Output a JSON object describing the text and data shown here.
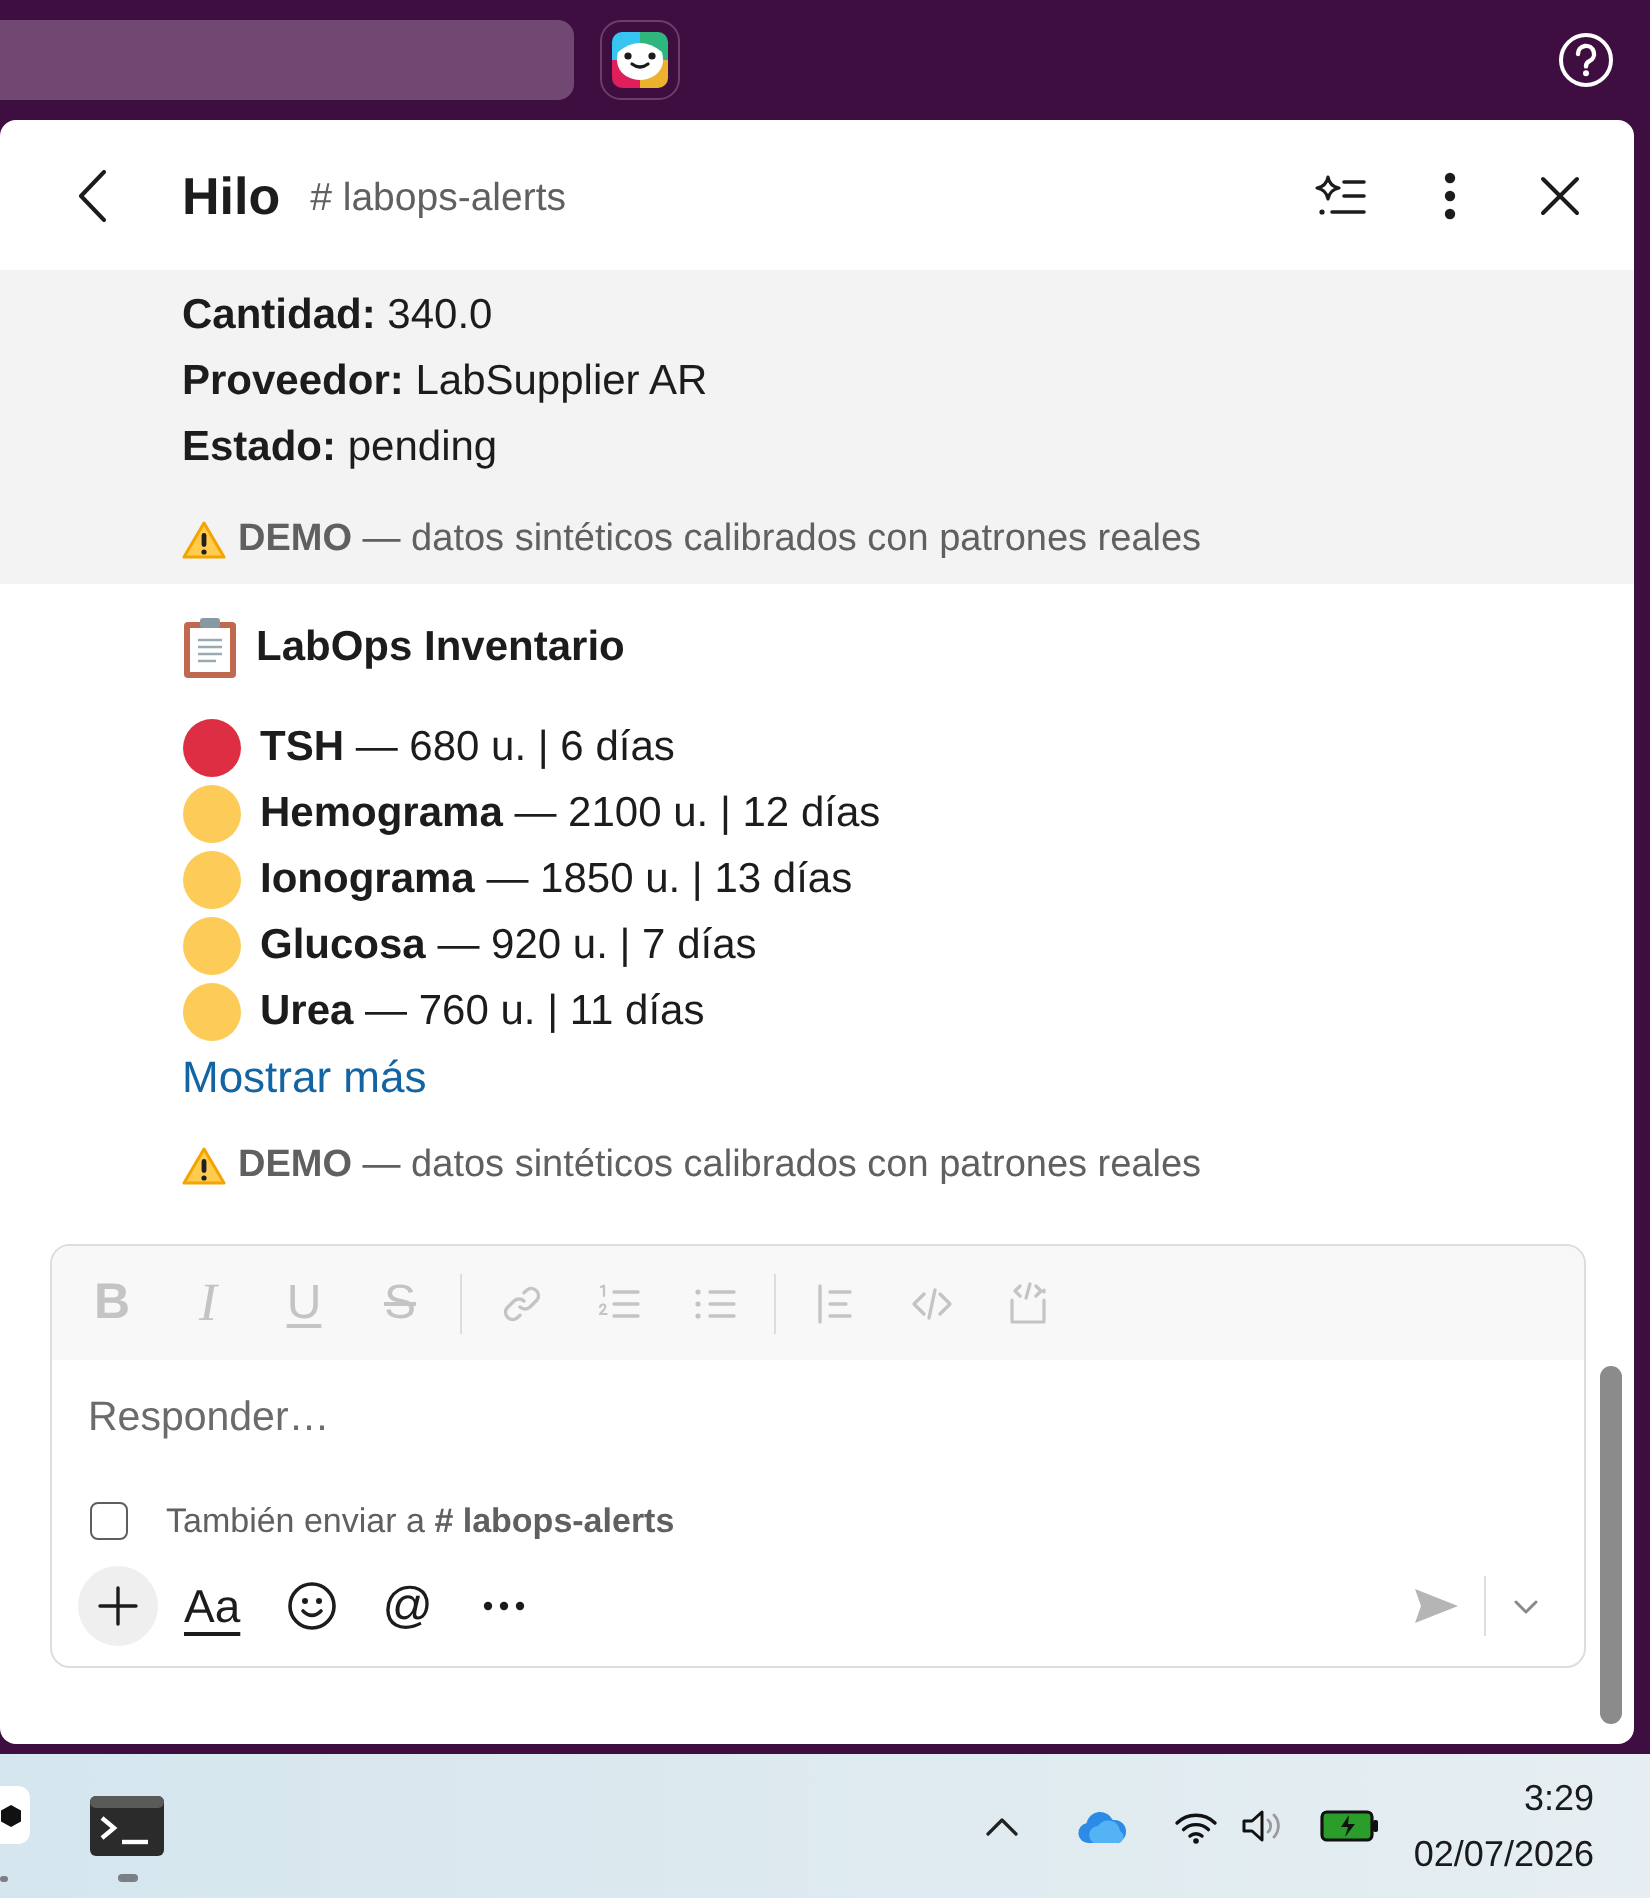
{
  "thread": {
    "title": "Hilo",
    "channel": "# labops-alerts"
  },
  "messages": [
    {
      "kind": "fields",
      "highlighted": true,
      "lines": [
        "**Cantidad:** 340.0",
        "**Proveedor:** LabSupplier AR",
        "**Estado:** pending"
      ],
      "note": "**DEMO** — datos sintéticos calibrados con patrones reales"
    },
    {
      "kind": "inventory",
      "highlighted": false,
      "title": "LabOps Inventario",
      "items": [
        {
          "text": "**TSH** — 680 u. | 6 días",
          "color": "#dd2e44"
        },
        {
          "text": "**Hemograma** — 2100 u. | 12 días",
          "color": "#fdcb58"
        },
        {
          "text": "**Ionograma** — 1850 u. | 13 días",
          "color": "#fdcb58"
        },
        {
          "text": "**Glucosa** — 920 u. | 7 días",
          "color": "#fdcb58"
        },
        {
          "text": "**Urea** — 760 u. | 11 días",
          "color": "#fdcb58"
        }
      ],
      "more_link": "Mostrar más",
      "note": "**DEMO** — datos sintéticos calibrados con patrones reales"
    }
  ],
  "composer": {
    "formatting_disabled": true,
    "format_buttons": [
      {
        "kind": "bold",
        "glyph": "B"
      },
      {
        "kind": "italic",
        "glyph": "I"
      },
      {
        "kind": "underline",
        "glyph": "U"
      },
      {
        "kind": "strike",
        "glyph": "S"
      },
      {
        "kind": "divider"
      },
      {
        "kind": "link"
      },
      {
        "kind": "ordered-list"
      },
      {
        "kind": "bulleted-list"
      },
      {
        "kind": "divider"
      },
      {
        "kind": "quote"
      },
      {
        "kind": "code"
      },
      {
        "kind": "code-block"
      }
    ],
    "placeholder": "Responder…",
    "also_send": {
      "label": "También enviar a **# labops-alerts**",
      "checked": false
    },
    "format_toggle": "Aa",
    "mention": "@",
    "send_disabled": true
  },
  "taskbar": {
    "apps": [
      {
        "kind": "hexagon",
        "running": true
      },
      {
        "kind": "terminal",
        "running": true
      }
    ],
    "time": "3:29",
    "date": "02/07/2026"
  }
}
